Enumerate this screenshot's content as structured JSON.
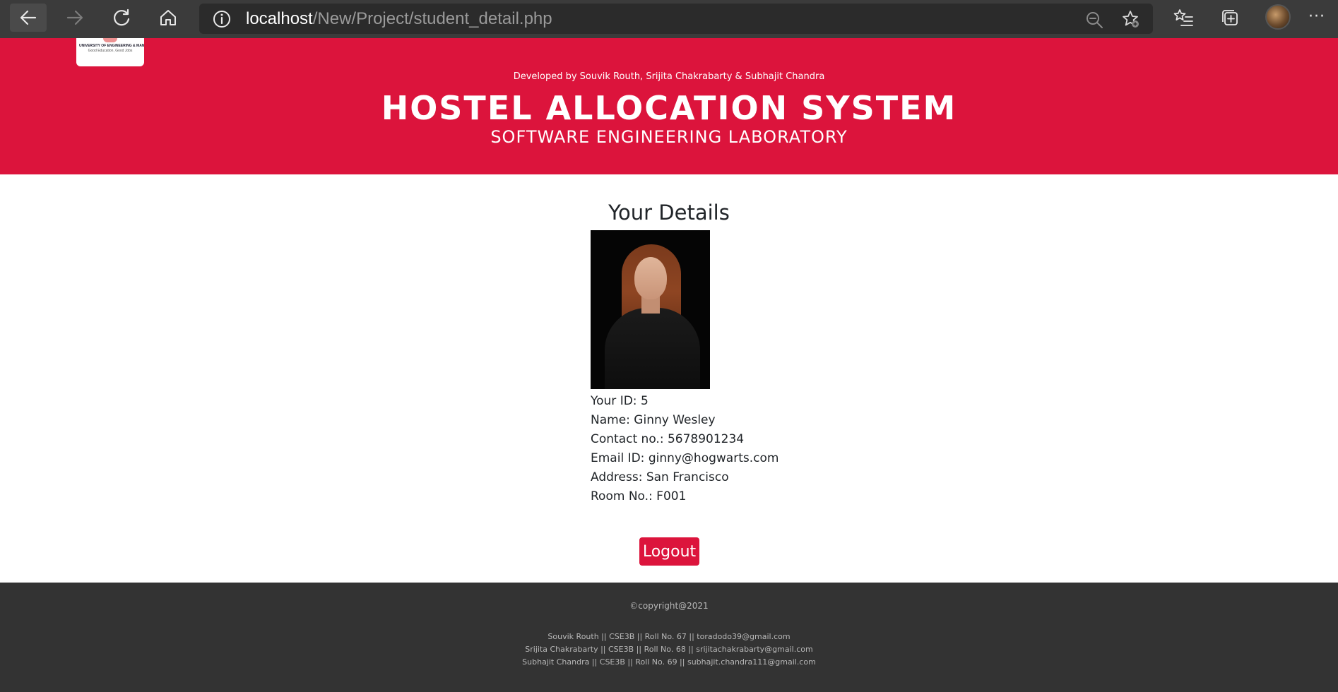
{
  "browser": {
    "url_host": "localhost",
    "url_path": "/New/Project/student_detail.php",
    "icons": {
      "back": "arrow-left-icon",
      "forward": "arrow-right-icon",
      "refresh": "refresh-icon",
      "home": "home-icon",
      "info": "info-icon",
      "zoom": "zoom-out-icon",
      "add_favorite": "star-plus-icon",
      "favorites": "favorites-list-icon",
      "collections": "collections-icon",
      "more": "more-icon"
    }
  },
  "header": {
    "logo_line1": "UNIVERSITY OF ENGINEERING & MANAGEMENT",
    "logo_line2": "Good Education, Good Jobs",
    "developer_credit": "Developed by Souvik Routh, Srijita Chakrabarty & Subhajit Chandra",
    "title": "HOSTEL ALLOCATION SYSTEM",
    "subtitle": "SOFTWARE ENGINEERING LABORATORY",
    "background_color": "#dc143c"
  },
  "main": {
    "heading": "Your Details",
    "details": [
      {
        "label": "Your ID:",
        "value": "5"
      },
      {
        "label": "Name:",
        "value": "Ginny Wesley"
      },
      {
        "label": "Contact no.:",
        "value": "5678901234"
      },
      {
        "label": "Email ID:",
        "value": "ginny@hogwarts.com"
      },
      {
        "label": "Address:",
        "value": "San Francisco"
      },
      {
        "label": "Room No.:",
        "value": "F001"
      }
    ],
    "logout_label": "Logout"
  },
  "footer": {
    "copyright": "©copyright@2021",
    "credits": [
      "Souvik Routh || CSE3B || Roll No. 67 || toradodo39@gmail.com",
      "Srijita Chakrabarty || CSE3B || Roll No. 68 || srijitachakrabarty@gmail.com",
      "Subhajit Chandra || CSE3B || Roll No. 69 || subhajit.chandra111@gmail.com"
    ],
    "background_color": "#333333"
  }
}
